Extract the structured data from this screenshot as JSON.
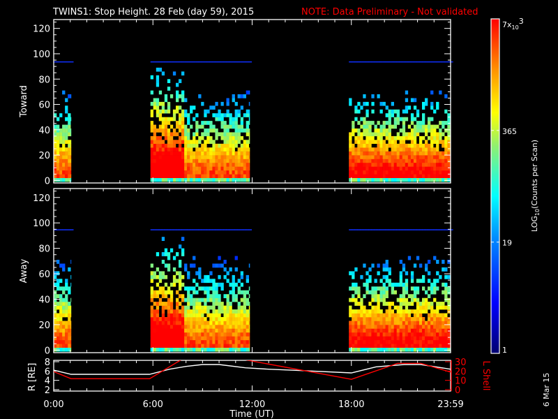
{
  "title": "TWINS1: Stop Height. 28 Feb (day  59), 2015",
  "note": "NOTE: Data Preliminary - Not validated",
  "date_stamp": "6 Mar 15",
  "colors": {
    "background": "#000000",
    "axes": "#ffffff",
    "note": "#ff0000",
    "lshell": "#ff0000",
    "radius": "#ffffff"
  },
  "chart_data": [
    {
      "type": "heatmap",
      "name": "toward",
      "ylabel": "Toward",
      "ylim": [
        -2,
        127
      ],
      "yticks": [
        0,
        20,
        40,
        60,
        80,
        100,
        120
      ],
      "xlim_hours": [
        0,
        24
      ],
      "coverage_hours": [
        [
          0,
          1.05
        ],
        [
          5.85,
          11.85
        ],
        [
          17.85,
          24
        ]
      ],
      "max_height": 93
    },
    {
      "type": "heatmap",
      "name": "away",
      "ylabel": "Away",
      "ylim": [
        -2,
        127
      ],
      "yticks": [
        0,
        20,
        40,
        60,
        80,
        100,
        120
      ],
      "xlim_hours": [
        0,
        24
      ],
      "coverage_hours": [
        [
          0,
          1.05
        ],
        [
          5.85,
          11.85
        ],
        [
          17.85,
          24
        ]
      ],
      "max_height": 94
    },
    {
      "type": "line",
      "name": "orbit",
      "ylabel": "R [RE]",
      "y2label": "L Shell",
      "ylim": [
        2,
        8
      ],
      "y2lim": [
        0,
        30
      ],
      "yticks": [
        "2",
        "4",
        "6",
        "8"
      ],
      "y2ticks": [
        "0",
        "10",
        "20",
        "30"
      ],
      "xlabel": "Time (UT)",
      "xtick_labels": [
        "0:00",
        "6:00",
        "12:00",
        "18:00",
        "23:59"
      ],
      "xtick_hours": [
        0,
        6,
        12,
        18,
        24
      ],
      "series": [
        {
          "name": "R",
          "x": [
            0,
            1.05,
            5.8,
            7,
            8,
            9,
            10,
            11.6,
            13,
            15,
            18,
            19.5,
            21.2,
            22.2,
            24
          ],
          "y": [
            6.2,
            5.3,
            5.3,
            6.4,
            7.0,
            7.4,
            7.4,
            6.7,
            6.4,
            6.1,
            5.6,
            6.9,
            7.4,
            7.4,
            6.4
          ]
        },
        {
          "name": "L Shell",
          "x": [
            0,
            1.05,
            5.8,
            7.7
          ],
          "y": [
            19.4,
            11.8,
            11.8,
            32
          ]
        },
        {
          "name": "L Shell",
          "x": [
            11.6,
            18,
            20.8,
            22.2,
            24
          ],
          "y": [
            32,
            11.1,
            28.3,
            28.3,
            18.9
          ]
        }
      ]
    }
  ],
  "colorbar": {
    "label": "LOG10(Counts per Scan)",
    "label_main": "LOG",
    "label_sub": "10",
    "label_rest": "(Counts per Scan)",
    "range": [
      1,
      7000
    ],
    "ticks": [
      {
        "value": 1,
        "label": "1"
      },
      {
        "value": 19,
        "label": "19"
      },
      {
        "value": 365,
        "label": "365"
      }
    ],
    "top_label_base": "7x",
    "top_label_sub": "10",
    "top_label_exp": "3"
  }
}
